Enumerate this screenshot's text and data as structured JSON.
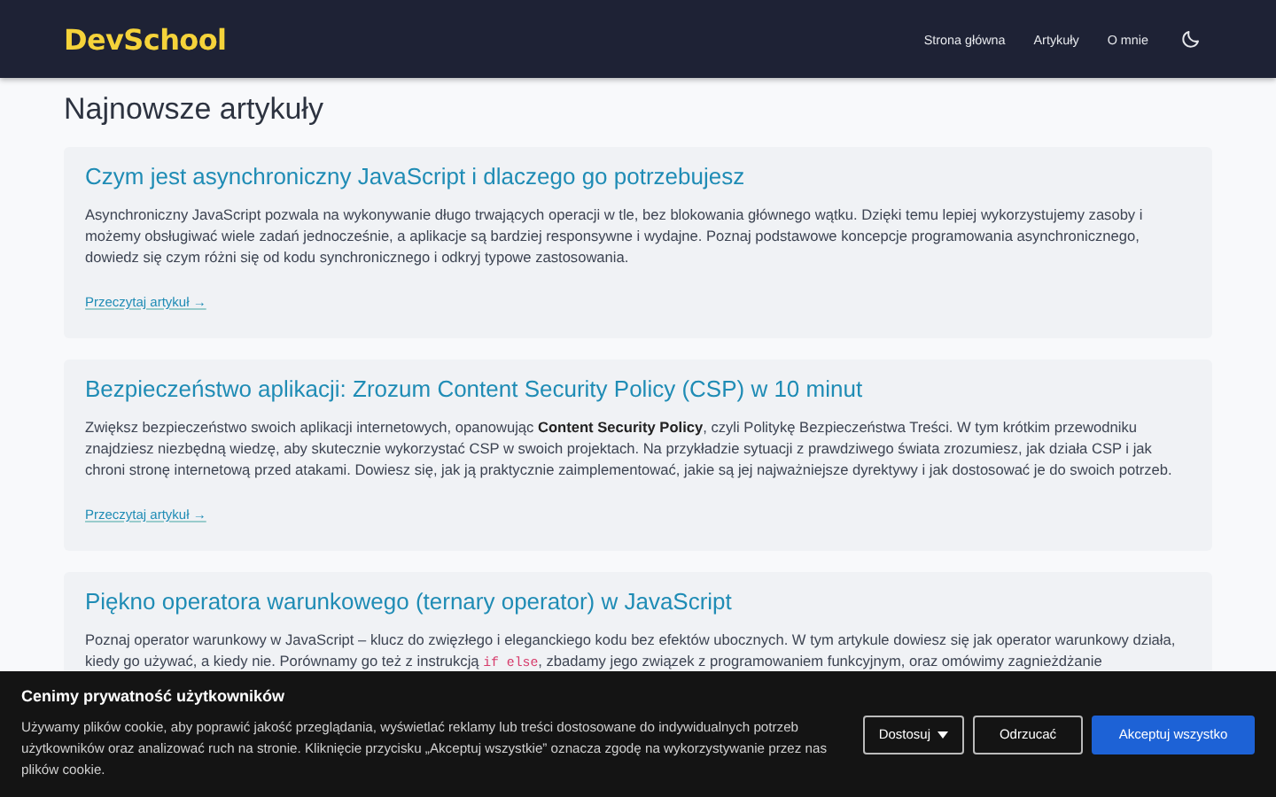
{
  "header": {
    "logo": "DevSchool",
    "nav": [
      "Strona główna",
      "Artykuły",
      "O mnie"
    ]
  },
  "heading": "Najnowsze artykuły",
  "articles": [
    {
      "title": "Czym jest asynchroniczny JavaScript i dlaczego go potrzebujesz",
      "body": [
        {
          "kind": "text",
          "text": "Asynchroniczny JavaScript pozwala na wykonywanie długo trwających operacji w tle, bez blokowania głównego wątku. Dzięki temu lepiej wykorzystujemy zasoby i możemy obsługiwać wiele zadań jednocześnie, a aplikacje są bardziej responsywne i wydajne. Poznaj podstawowe koncepcje programowania asynchronicznego, dowiedz się czym różni się od kodu synchronicznego i odkryj typowe zastosowania."
        }
      ],
      "link": "Przeczytaj artykuł →"
    },
    {
      "title": "Bezpieczeństwo aplikacji: Zrozum Content Security Policy (CSP) w 10 minut",
      "body": [
        {
          "kind": "text",
          "text": "Zwiększ bezpieczeństwo swoich aplikacji internetowych, opanowując "
        },
        {
          "kind": "bold",
          "text": "Content Security Policy"
        },
        {
          "kind": "text",
          "text": ", czyli Politykę Bezpieczeństwa Treści. W tym krótkim przewodniku znajdziesz niezbędną wiedzę, aby skutecznie wykorzystać CSP w swoich projektach. Na przykładzie sytuacji z prawdziwego świata zrozumiesz, jak działa CSP i jak chroni stronę internetową przed atakami. Dowiesz się, jak ją praktycznie zaimplementować, jakie są jej najważniejsze dyrektywy i jak dostosować je do swoich potrzeb."
        }
      ],
      "link": "Przeczytaj artykuł →"
    },
    {
      "title": "Piękno operatora warunkowego (ternary operator) w JavaScript",
      "body": [
        {
          "kind": "text",
          "text": "Poznaj operator warunkowy w JavaScript – klucz do zwięzłego i eleganckiego kodu bez efektów ubocznych. W tym artykule dowiesz się jak operator warunkowy działa, kiedy go używać, a kiedy nie. Porównamy go też z instrukcją "
        },
        {
          "kind": "code",
          "text": "if else"
        },
        {
          "kind": "text",
          "text": ", zbadamy jego związek z programowaniem funkcyjnym, oraz omówimy zagnieżdżanie"
        }
      ]
    }
  ],
  "cookie_banner": {
    "title": "Cenimy prywatność użytkowników",
    "text": "Używamy plików cookie, aby poprawić jakość przeglądania, wyświetlać reklamy lub treści dostosowane do indywidualnych potrzeb użytkowników oraz analizować ruch na stronie. Kliknięcie przycisku „Akceptuj wszystkie” oznacza zgodę na wykorzystywanie przez nas plików cookie.",
    "buttons": [
      {
        "label": "Dostosuj",
        "kind": "dropdown"
      },
      {
        "label": "Odrzucać",
        "kind": "outline"
      },
      {
        "label": "Akceptuj wszystko",
        "kind": "primary"
      }
    ]
  }
}
